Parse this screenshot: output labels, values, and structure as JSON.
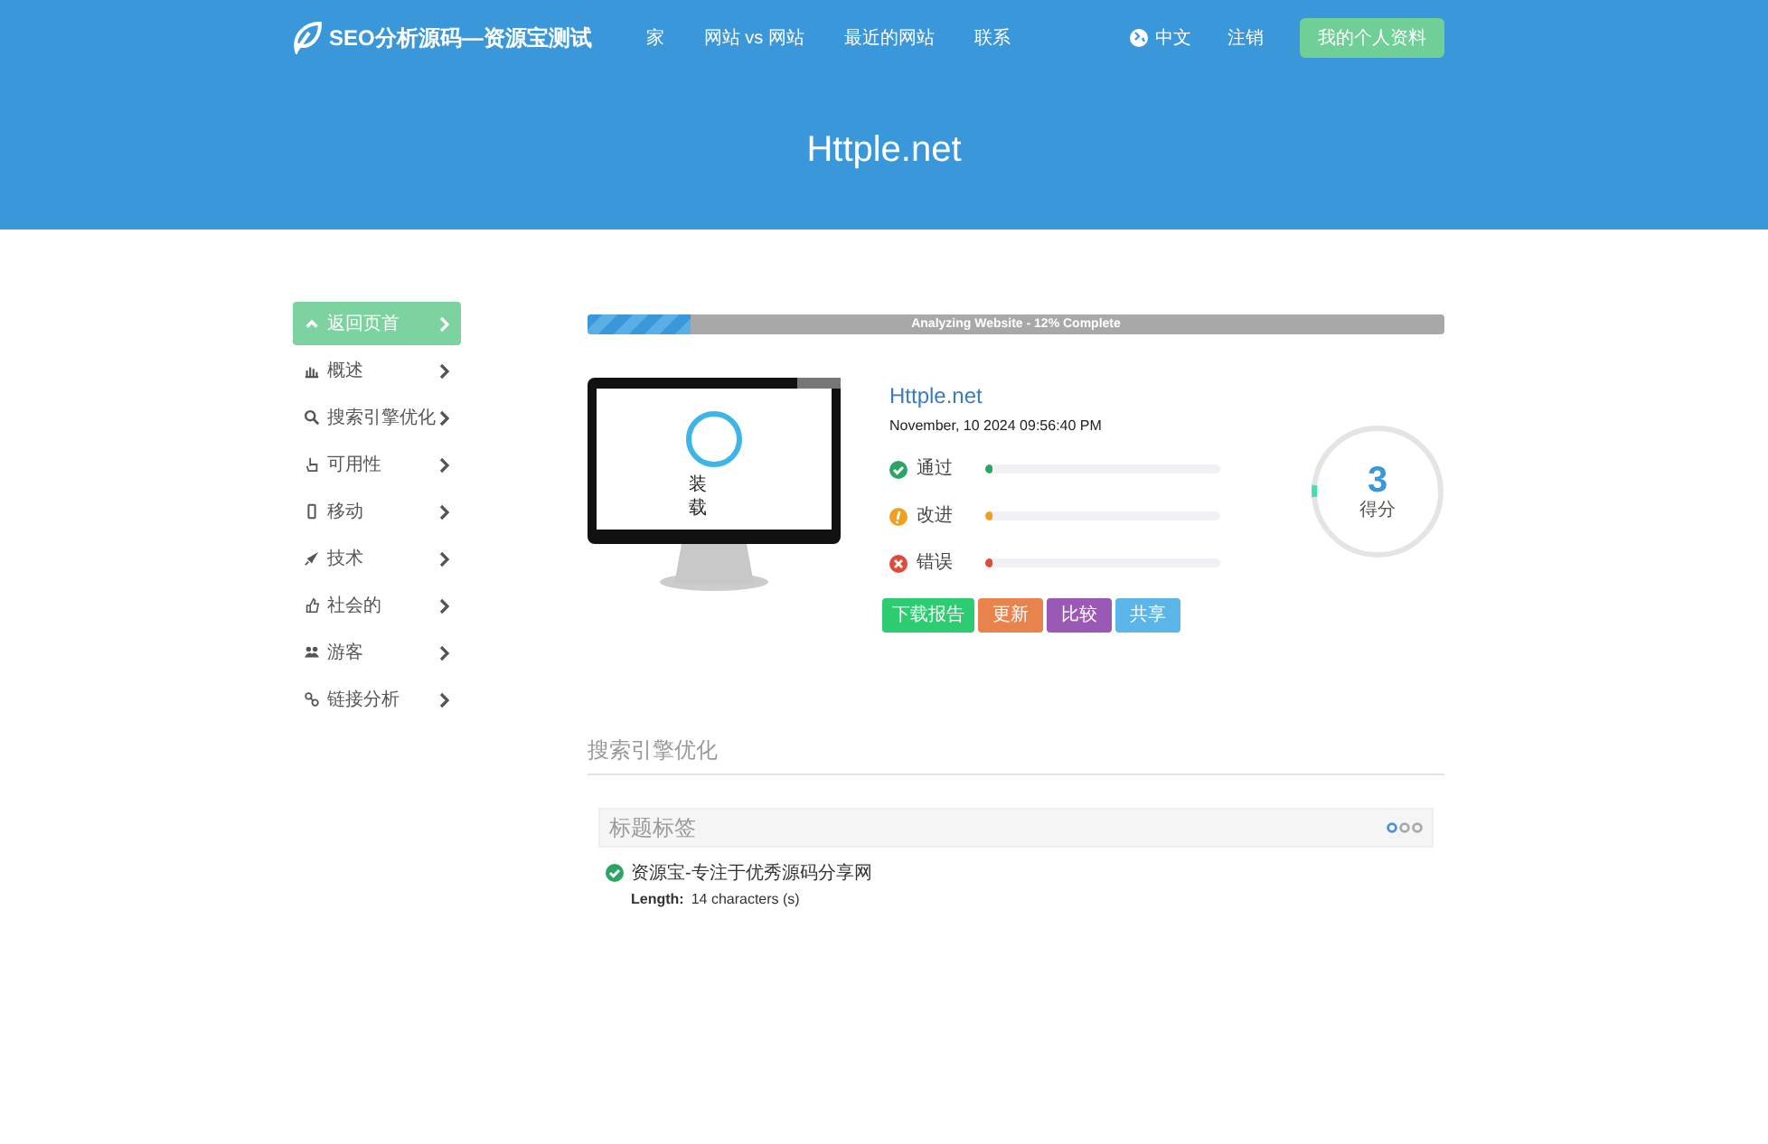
{
  "nav": {
    "logo": "SEO分析源码—资源宝测试",
    "links": [
      "家",
      "网站 vs 网站",
      "最近的网站",
      "联系"
    ],
    "language": "中文",
    "logout": "注销",
    "profile_button": "我的个人资料"
  },
  "hero": {
    "title": "Httple.net"
  },
  "sidebar": {
    "items": [
      {
        "label": "返回页首",
        "selected": true
      },
      {
        "label": "概述",
        "selected": false
      },
      {
        "label": "搜索引擎优化",
        "selected": false
      },
      {
        "label": "可用性",
        "selected": false
      },
      {
        "label": "移动",
        "selected": false
      },
      {
        "label": "技术",
        "selected": false
      },
      {
        "label": "社会的",
        "selected": false
      },
      {
        "label": "游客",
        "selected": false
      },
      {
        "label": "链接分析",
        "selected": false
      }
    ]
  },
  "progress": {
    "label": "Analyzing Website - 12% Complete",
    "level": 0.12
  },
  "preview": {
    "loading_text": "装载"
  },
  "summary": {
    "site": "Httple.net",
    "date": "November, 10 2024 09:56:40 PM",
    "results": [
      {
        "kind": "pass",
        "label": "通过",
        "level": 0.02
      },
      {
        "kind": "improve",
        "label": "改进",
        "level": 0.02
      },
      {
        "kind": "error",
        "label": "错误",
        "level": 0.02
      }
    ],
    "score": {
      "value": "3",
      "label": "得分",
      "level": 0.03
    },
    "buttons": [
      {
        "kind": "download",
        "label": "下载报告"
      },
      {
        "kind": "update",
        "label": "更新"
      },
      {
        "kind": "compare",
        "label": "比较"
      },
      {
        "kind": "share",
        "label": "共享"
      }
    ]
  },
  "section": {
    "title": "搜索引擎优化",
    "panel": {
      "title": "标题标签",
      "dots": [
        {
          "selected": true
        },
        {
          "selected": false
        },
        {
          "selected": false
        }
      ],
      "value": "资源宝-专注于优秀源码分享网",
      "length_label": "Length:",
      "length_value": "14 characters (s)"
    }
  }
}
